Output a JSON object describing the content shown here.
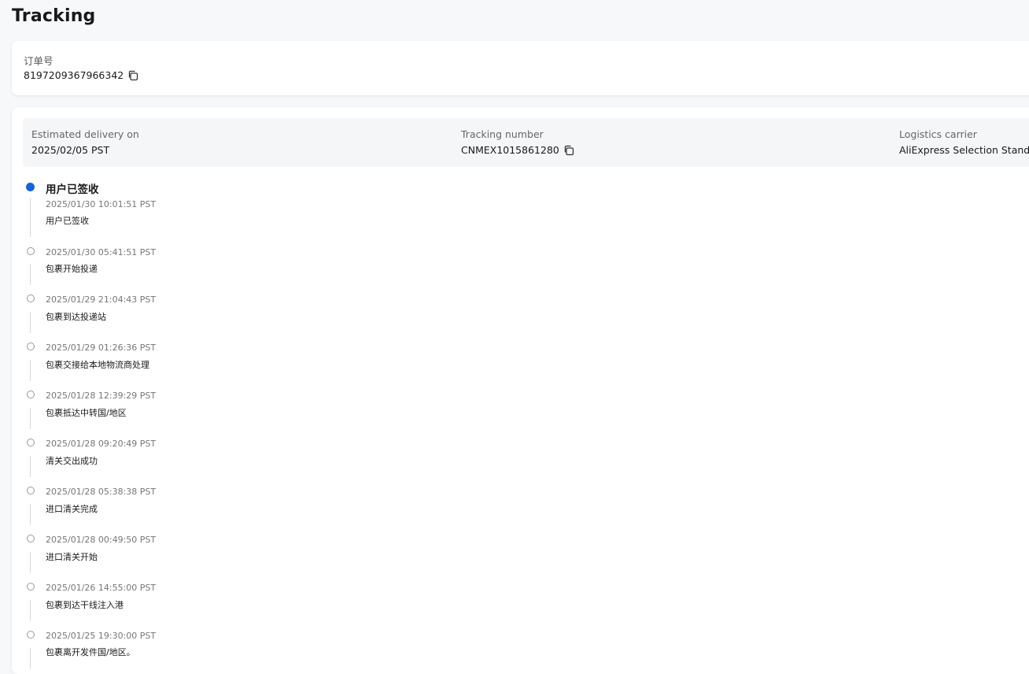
{
  "page": {
    "title": "Tracking"
  },
  "order": {
    "label": "订单号",
    "number": "8197209367966342"
  },
  "summary": {
    "estimated_label": "Estimated delivery on",
    "estimated_value": "2025/02/05 PST",
    "tracking_label": "Tracking number",
    "tracking_value": "CNMEX1015861280",
    "carrier_label": "Logistics carrier",
    "carrier_value": "AliExpress Selection Standar"
  },
  "timeline": {
    "current_status": "用户已签收",
    "events": [
      {
        "time": "2025/01/30 10:01:51 PST",
        "desc": "用户已签收"
      },
      {
        "time": "2025/01/30 05:41:51 PST",
        "desc": "包裹开始投递"
      },
      {
        "time": "2025/01/29 21:04:43 PST",
        "desc": "包裹到达投递站"
      },
      {
        "time": "2025/01/29 01:26:36 PST",
        "desc": "包裹交接给本地物流商处理"
      },
      {
        "time": "2025/01/28 12:39:29 PST",
        "desc": "包裹抵达中转国/地区"
      },
      {
        "time": "2025/01/28 09:20:49 PST",
        "desc": "清关交出成功"
      },
      {
        "time": "2025/01/28 05:38:38 PST",
        "desc": "进口清关完成"
      },
      {
        "time": "2025/01/28 00:49:50 PST",
        "desc": "进口清关开始"
      },
      {
        "time": "2025/01/26 14:55:00 PST",
        "desc": "包裹到达干线注入港"
      },
      {
        "time": "2025/01/25 19:30:00 PST",
        "desc": "包裹离开发件国/地区。"
      }
    ]
  },
  "icons": {
    "copy": "copy-icon",
    "accent_color": "#1a62d8"
  }
}
